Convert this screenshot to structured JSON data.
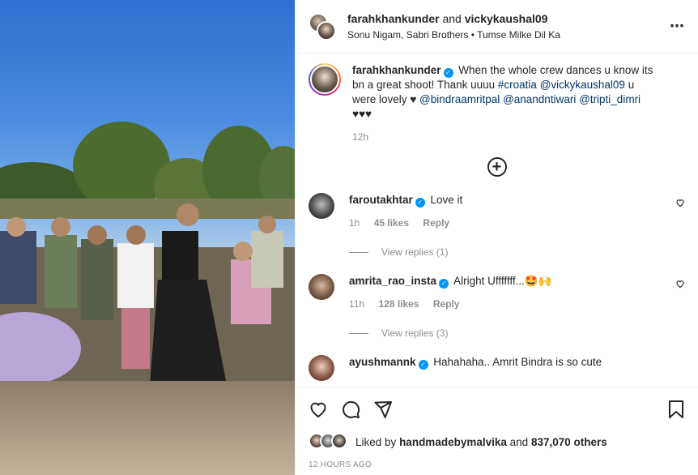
{
  "header": {
    "user1": "farahkhankunder",
    "conjunction": "and",
    "user2": "vickykaushal09",
    "audio_artists": "Sonu Nigam, Sabri Brothers",
    "audio_separator": "•",
    "audio_title": "Tumse Milke Dil Ka",
    "more_icon": "⋯"
  },
  "caption": {
    "username": "farahkhankunder",
    "text_1": "When the whole crew dances u know its bn a great shoot! Thank uuuu ",
    "hashtag": "#croatia",
    "mention_1": "@vickykaushal09",
    "text_2": " u were lovely ♥ ",
    "mention_2": "@bindraamritpal",
    "mention_3": "@anandntiwari",
    "mention_4": "@tripti_dimri",
    "text_3": " ♥♥♥",
    "time": "12h"
  },
  "comments": [
    {
      "username": "faroutakhtar",
      "text": "Love it",
      "time": "1h",
      "likes": "45 likes",
      "reply_label": "Reply",
      "view_replies": "View replies (1)"
    },
    {
      "username": "amrita_rao_insta",
      "text": "Alright Ufffffff...🤩🙌",
      "time": "11h",
      "likes": "128 likes",
      "reply_label": "Reply",
      "view_replies": "View replies (3)"
    },
    {
      "username": "ayushmannk",
      "text": "Hahahaha.. Amrit Bindra is so cute"
    }
  ],
  "footer": {
    "liked_by_prefix": "Liked by",
    "liked_by_user": "handmadebymalvika",
    "liked_by_and": "and",
    "others": "837,070 others",
    "timestamp": "12 HOURS AGO"
  },
  "colors": {
    "verified": "#0095f6",
    "link": "#00376b",
    "muted": "#8e8e8e"
  }
}
